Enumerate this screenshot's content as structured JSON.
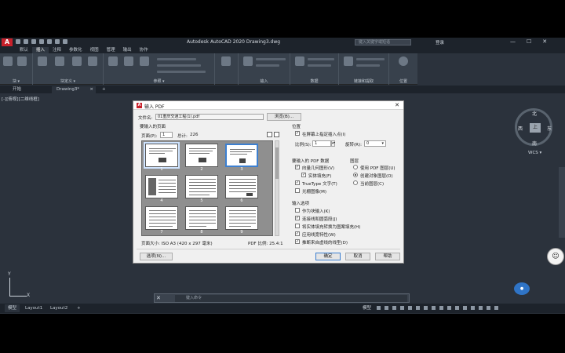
{
  "app": {
    "title": "Autodesk AutoCAD 2020    Drawing3.dwg",
    "search_placeholder": "键入关键字或短语",
    "login": "登录",
    "window_buttons": [
      "—",
      "☐",
      "✕"
    ],
    "logo_letter": "A"
  },
  "menu": {
    "tabs": [
      "默认",
      "插入",
      "注释",
      "参数化",
      "视图",
      "管理",
      "输出",
      "协作"
    ],
    "active_index": 1
  },
  "ribbon": {
    "panels": [
      "块 ▾",
      "块定义 ▾",
      "参照 ▾",
      "",
      "输入",
      "数据",
      "链接和提取",
      "位置"
    ]
  },
  "file_tabs": {
    "items": [
      "开始",
      "Drawing3*"
    ],
    "add": "+",
    "close": "×"
  },
  "viewport": {
    "label": "[-][俯视][二维线框]",
    "compass": {
      "n": "北",
      "s": "南",
      "w": "西",
      "e": "东",
      "cube": "上"
    },
    "wcs": "WCS ▾",
    "ucs_y": "Y",
    "ucs_x": "X"
  },
  "command": {
    "close": "✕",
    "placeholder": "键入命令"
  },
  "statusbar": {
    "tabs": [
      "模型",
      "Layout1",
      "Layout2"
    ],
    "add": "+",
    "model_label": "模型"
  },
  "dialog": {
    "title": "输入 PDF",
    "icon": "A",
    "close": "✕",
    "file_label": "文件名:",
    "file_value": "01重庆交通工程(1).pdf",
    "browse": "浏览(B)...",
    "pages_label": "要输入的页面",
    "page_label": "页面(P):",
    "page_value": "1",
    "total_label": "总计:",
    "total_value": "226",
    "thumb_numbers": [
      "1",
      "2",
      "3",
      "4",
      "5",
      "6",
      "7",
      "8",
      "9"
    ],
    "selected_thumb": 3,
    "page_size": "页面大小: ISO A3 (420 x 297 毫米)",
    "pdf_scale": "PDF 比例: 25.4:1",
    "position": {
      "title": "位置",
      "specify_on_screen": "在屏幕上指定插入点(I)",
      "scale_label": "比例(S):",
      "scale_value": "1",
      "rotation_label": "旋转(R):",
      "rotation_value": "0"
    },
    "pdf_data": {
      "title": "要输入的 PDF 数据",
      "vector": "向量几何图形(V)",
      "solid_fill": "实体填充(F)",
      "truetype": "TrueType 文字(T)",
      "raster": "光栅图像(M)"
    },
    "layers": {
      "title": "图层",
      "use_pdf": "使用 PDF 图层(U)",
      "create_object": "创建对象图层(O)",
      "current": "当前图层(C)"
    },
    "options": {
      "title": "输入选项",
      "as_block": "作为块输入(K)",
      "join_lines": "连接线和圆弧段(J)",
      "convert_solid": "将实体填充转换为图案填充(H)",
      "apply_weight": "应用线宽特性(W)",
      "infer_lines": "推断来自虚线的线型(D)"
    },
    "settings_btn": "选项(N)...",
    "ok": "确定",
    "cancel": "取消",
    "help": "帮助"
  }
}
